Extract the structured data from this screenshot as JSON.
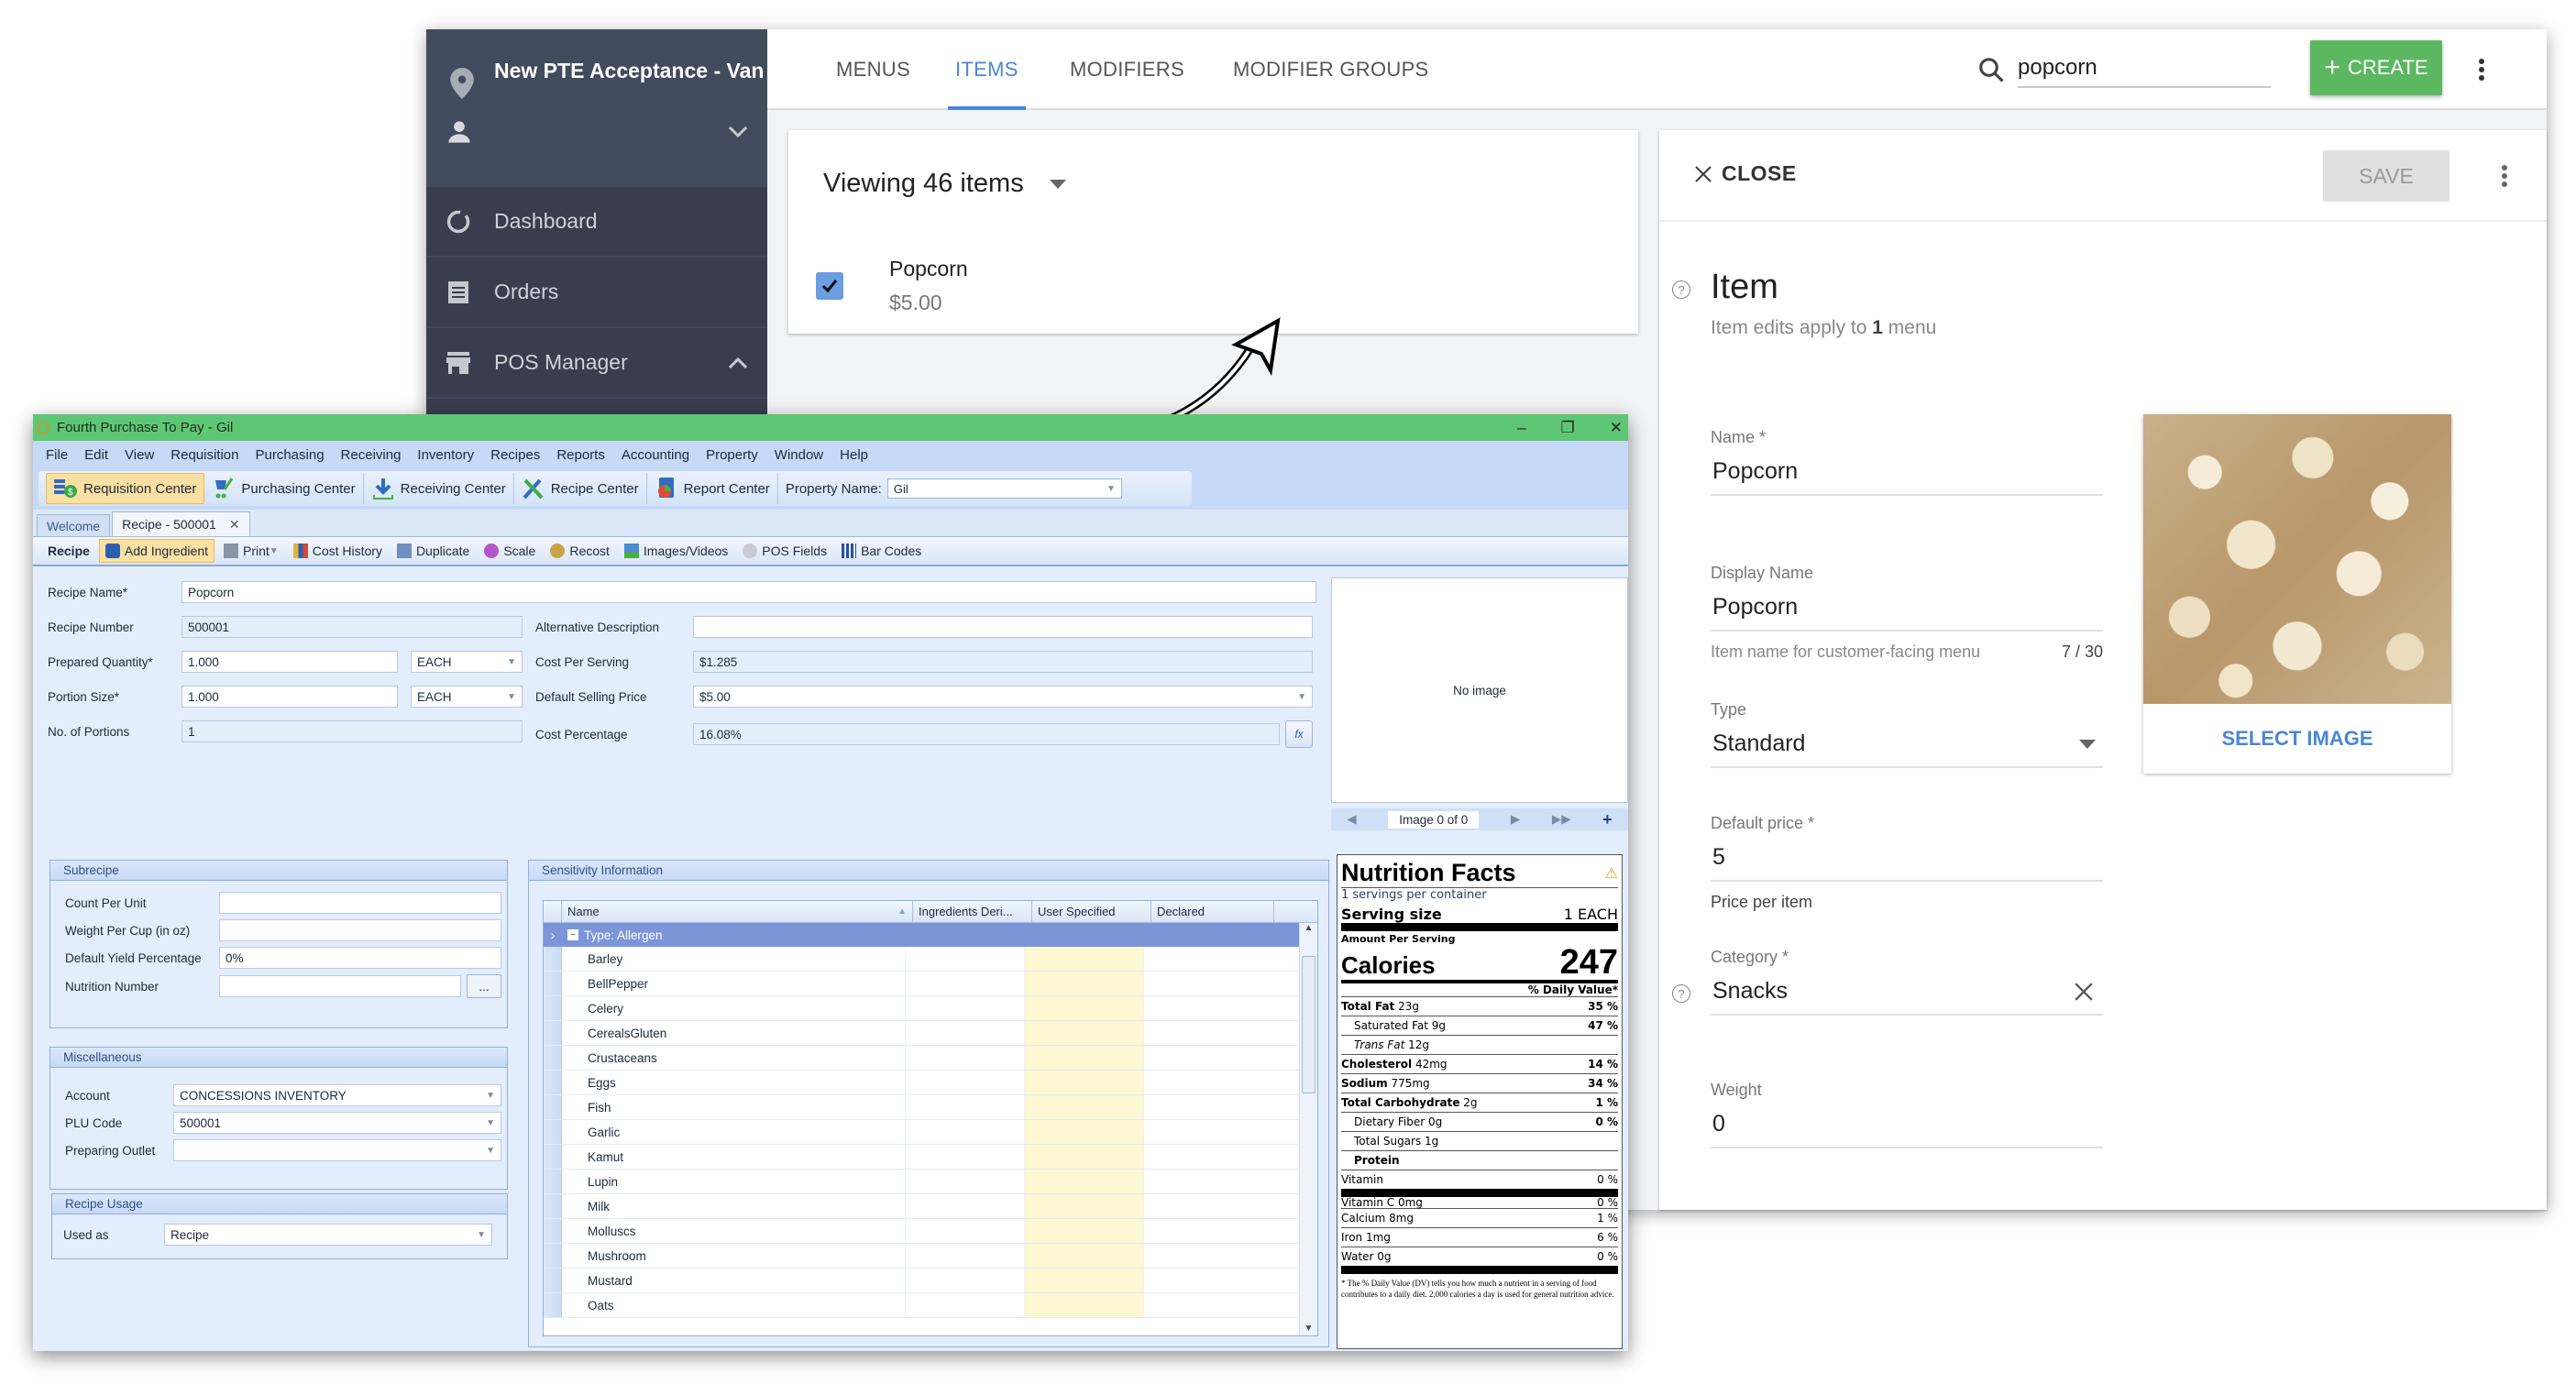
{
  "web": {
    "sidebar": {
      "location_title": "New PTE Acceptance - Van",
      "user_name": "",
      "items": [
        {
          "label": "Dashboard",
          "icon": "dashboard-icon"
        },
        {
          "label": "Orders",
          "icon": "receipt-icon"
        },
        {
          "label": "POS Manager",
          "icon": "store-icon",
          "expanded": true
        }
      ]
    },
    "tabs": [
      {
        "label": "MENUS",
        "active": false
      },
      {
        "label": "ITEMS",
        "active": true
      },
      {
        "label": "MODIFIERS",
        "active": false
      },
      {
        "label": "MODIFIER GROUPS",
        "active": false
      }
    ],
    "search": {
      "value": "popcorn"
    },
    "create_label": "CREATE",
    "list": {
      "viewing_label": "Viewing 46 items",
      "items": [
        {
          "name": "Popcorn",
          "price": "$5.00",
          "checked": true
        }
      ]
    },
    "detail": {
      "close_label": "CLOSE",
      "save_label": "SAVE",
      "title": "Item",
      "subtitle_prefix": "Item edits apply to ",
      "subtitle_count": "1",
      "subtitle_suffix": " menu",
      "fields": {
        "name": {
          "label": "Name *",
          "value": "Popcorn"
        },
        "display_name": {
          "label": "Display Name",
          "value": "Popcorn",
          "hint": "Item name for customer-facing menu",
          "counter": "7 / 30"
        },
        "type": {
          "label": "Type",
          "value": "Standard"
        },
        "default_price": {
          "label": "Default price *",
          "value": "5",
          "hint": "Price per item"
        },
        "category": {
          "label": "Category *",
          "value": "Snacks"
        },
        "weight": {
          "label": "Weight",
          "value": "0"
        }
      },
      "select_image_label": "SELECT IMAGE"
    },
    "colors": {
      "accent": "#4a86d8",
      "create": "#5cb860",
      "sidebar": "#383e4e"
    }
  },
  "desktop": {
    "title": "Fourth Purchase To Pay - Gil",
    "menu": [
      "File",
      "Edit",
      "View",
      "Requisition",
      "Purchasing",
      "Receiving",
      "Inventory",
      "Recipes",
      "Reports",
      "Accounting",
      "Property",
      "Window",
      "Help"
    ],
    "toolbar": [
      {
        "label": "Requisition Center",
        "icon": "requisition-icon",
        "active": true
      },
      {
        "label": "Purchasing Center",
        "icon": "cart-icon"
      },
      {
        "label": "Receiving Center",
        "icon": "receiving-icon"
      },
      {
        "label": "Recipe Center",
        "icon": "utensils-icon"
      },
      {
        "label": "Report Center",
        "icon": "report-icon"
      }
    ],
    "property_name_label": "Property Name:",
    "property_name_value": "Gil",
    "doc_tabs": [
      {
        "label": "Welcome"
      },
      {
        "label": "Recipe - 500001",
        "active": true
      }
    ],
    "recipe_toolbar": [
      {
        "label": "Recipe"
      },
      {
        "label": "Add Ingredient",
        "active": true
      },
      {
        "label": "Print"
      },
      {
        "label": "Cost History"
      },
      {
        "label": "Duplicate"
      },
      {
        "label": "Scale"
      },
      {
        "label": "Recost"
      },
      {
        "label": "Images/Videos"
      },
      {
        "label": "POS Fields"
      },
      {
        "label": "Bar Codes"
      }
    ],
    "recipe": {
      "recipe_name": {
        "label": "Recipe Name*",
        "value": "Popcorn"
      },
      "recipe_number": {
        "label": "Recipe Number",
        "value": "500001"
      },
      "prepared_quantity": {
        "label": "Prepared Quantity*",
        "value": "1.000",
        "unit": "EACH"
      },
      "portion_size": {
        "label": "Portion Size*",
        "value": "1.000",
        "unit": "EACH"
      },
      "no_of_portions": {
        "label": "No. of Portions",
        "value": "1"
      },
      "alternative_description": {
        "label": "Alternative Description",
        "value": ""
      },
      "cost_per_serving": {
        "label": "Cost Per Serving",
        "value": "$1.285"
      },
      "default_selling_price": {
        "label": "Default Selling Price",
        "value": "$5.00"
      },
      "cost_percentage": {
        "label": "Cost Percentage",
        "value": "16.08%"
      }
    },
    "image_panel": {
      "no_image": "No image",
      "counter": "Image 0 of 0"
    },
    "subrecipe": {
      "title": "Subrecipe",
      "count_per_unit": {
        "label": "Count Per Unit",
        "value": ""
      },
      "weight_per_cup": {
        "label": "Weight Per Cup (in oz)",
        "value": ""
      },
      "default_yield": {
        "label": "Default Yield Percentage",
        "value": "0%"
      },
      "nutrition_number": {
        "label": "Nutrition Number",
        "value": "",
        "button": "..."
      }
    },
    "misc": {
      "title": "Miscellaneous",
      "account": {
        "label": "Account",
        "value": "CONCESSIONS INVENTORY"
      },
      "plu_code": {
        "label": "PLU Code",
        "value": "500001"
      },
      "preparing_outlet": {
        "label": "Preparing Outlet",
        "value": ""
      }
    },
    "usage": {
      "title": "Recipe Usage",
      "used_as": {
        "label": "Used as",
        "value": "Recipe"
      }
    },
    "sensitivity": {
      "title": "Sensitivity Information",
      "columns": [
        "Name",
        "Ingredients Deri...",
        "User Specified",
        "Declared"
      ],
      "group": "Type: Allergen",
      "rows": [
        "Barley",
        "BellPepper",
        "Celery",
        "CerealsGluten",
        "Crustaceans",
        "Eggs",
        "Fish",
        "Garlic",
        "Kamut",
        "Lupin",
        "Milk",
        "Molluscs",
        "Mushroom",
        "Mustard",
        "Oats"
      ]
    },
    "nutrition": {
      "title": "Nutrition Facts",
      "servings": "1 servings per container",
      "serving_size_label": "Serving size",
      "serving_size_value": "1 EACH",
      "amount_per_serving": "Amount Per Serving",
      "calories_label": "Calories",
      "calories_value": "247",
      "daily_value_label": "% Daily Value*",
      "rows": [
        {
          "label": "Total Fat",
          "amount": "23g",
          "dv": "35 %",
          "bold": true
        },
        {
          "label": "Saturated Fat",
          "amount": "9g",
          "dv": "47 %",
          "indent": true
        },
        {
          "label": "Trans Fat",
          "amount": "12g",
          "dv": "",
          "indent": true
        },
        {
          "label": "Cholesterol",
          "amount": "42mg",
          "dv": "14 %",
          "bold": true
        },
        {
          "label": "Sodium",
          "amount": "775mg",
          "dv": "34 %",
          "bold": true
        },
        {
          "label": "Total Carbohydrate",
          "amount": "2g",
          "dv": "1 %",
          "bold": true
        },
        {
          "label": "Dietary Fiber",
          "amount": "0g",
          "dv": "0 %",
          "indent": true
        },
        {
          "label": "Total Sugars",
          "amount": "1g",
          "dv": "",
          "indent": true
        },
        {
          "label": "Protein",
          "amount": "",
          "dv": "",
          "bold": true,
          "indent": true
        },
        {
          "label": "Vitamin",
          "amount": "",
          "dv": "0 %"
        }
      ],
      "minerals": [
        {
          "label": "Vitamin C",
          "amount": "0mg",
          "dv": "0 %"
        },
        {
          "label": "Calcium",
          "amount": "8mg",
          "dv": "1 %"
        },
        {
          "label": "Iron",
          "amount": "1mg",
          "dv": "6 %"
        },
        {
          "label": "Water",
          "amount": "0g",
          "dv": "0 %"
        }
      ],
      "footnote": "* The % Daily Value (DV) tells you how much a nutrient in a serving of food contributes to a daily diet. 2,000 calories a day is used for general nutrition advice."
    }
  }
}
